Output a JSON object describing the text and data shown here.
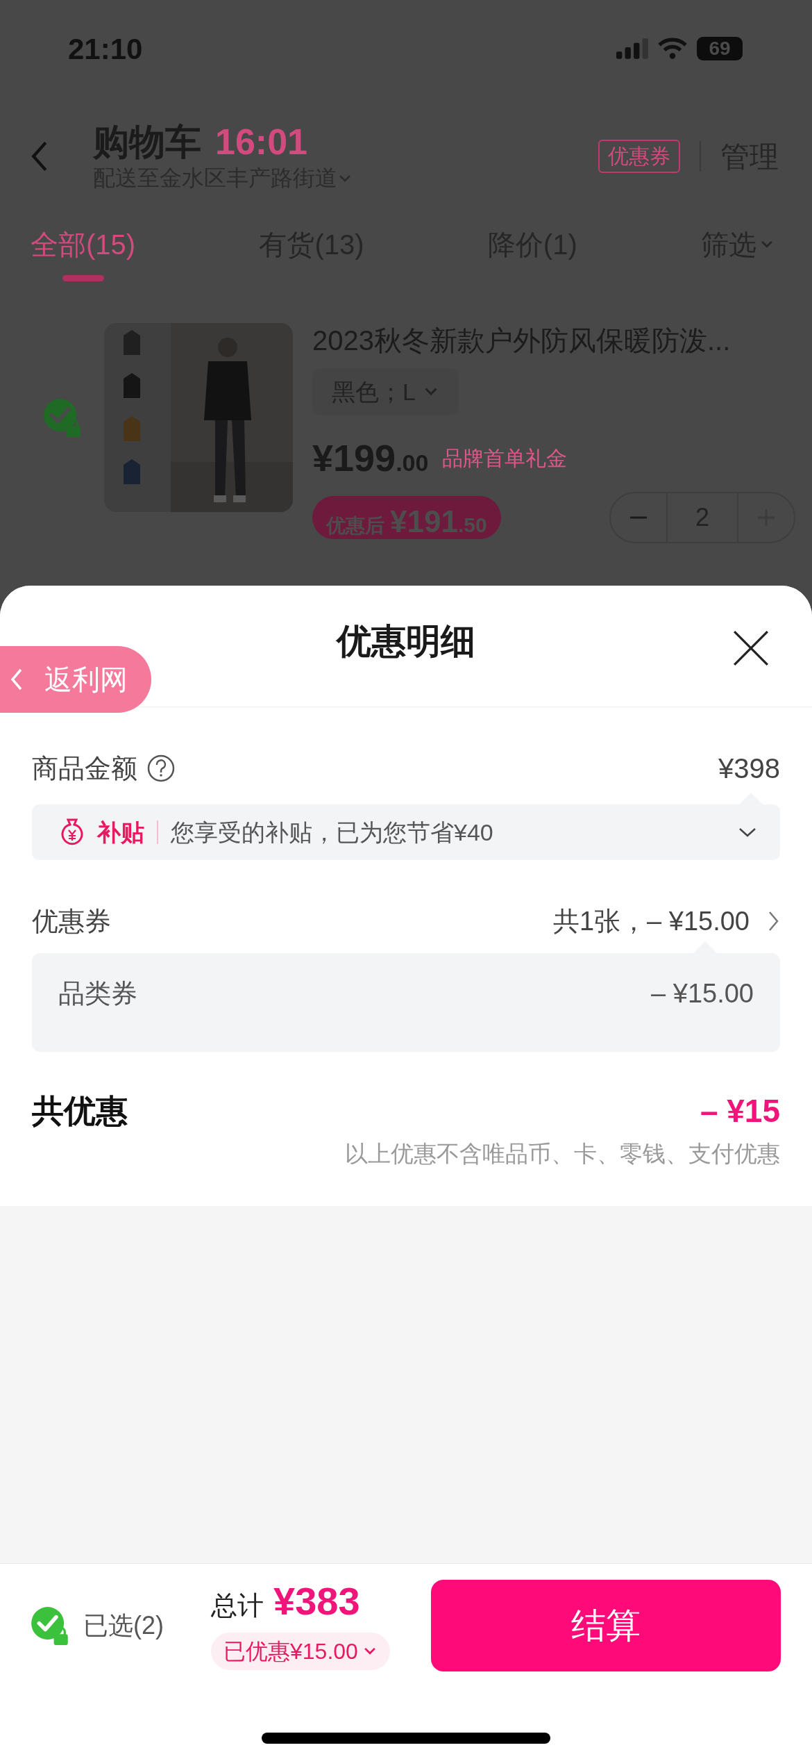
{
  "status_bar": {
    "time": "21:10",
    "battery": "69"
  },
  "header": {
    "title": "购物车",
    "countdown": "16:01",
    "address": "配送至金水区丰产路街道",
    "coupon_button": "优惠券",
    "manage": "管理"
  },
  "tabs": [
    {
      "label": "全部(15)",
      "selected": true
    },
    {
      "label": "有货(13)",
      "selected": false
    },
    {
      "label": "降价(1)",
      "selected": false
    },
    {
      "label": "筛选",
      "selected": false,
      "kind": "dropdown"
    }
  ],
  "product": {
    "checked": true,
    "title": "2023秋冬新款户外防风保暖防泼...",
    "variant": "黑色；L",
    "price_main": "¥199",
    "price_decimal": ".00",
    "tag": "品牌首单礼金",
    "after_label": "优惠后",
    "after_main": "¥191",
    "after_decimal": ".50",
    "quantity": "2",
    "increase_disabled": true
  },
  "sheet": {
    "title": "优惠明细",
    "side_tab": "返利网",
    "goods_label": "商品金额",
    "goods_value": "¥398",
    "subsidy": {
      "badge": "补贴",
      "text": "您享受的补贴，已为您节省¥40"
    },
    "coupon_label": "优惠券",
    "coupon_value": "共1张，– ¥15.00",
    "coupon_items": [
      {
        "name": "品类券",
        "amount": "– ¥15.00"
      }
    ],
    "total_label": "共优惠",
    "total_value": "– ¥15",
    "note": "以上优惠不含唯品币、卡、零钱、支付优惠"
  },
  "footer": {
    "all_checked": true,
    "selected_label": "已选(2)",
    "total_label": "总计",
    "total_value": "¥383",
    "saved": "已优惠¥15.00",
    "checkout": "结算"
  }
}
